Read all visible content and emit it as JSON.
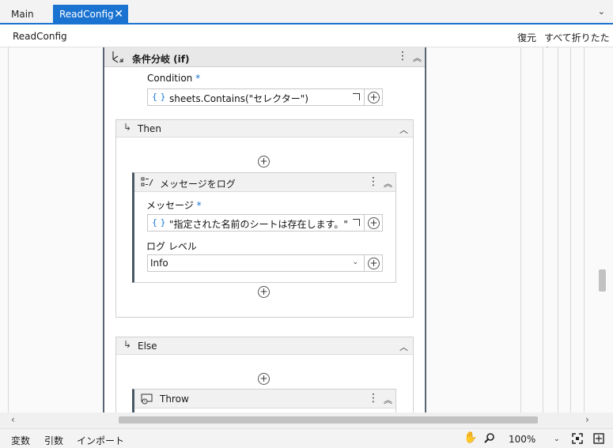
{
  "tabs": [
    {
      "label": "Main"
    },
    {
      "label": "ReadConfig"
    }
  ],
  "breadcrumb": "ReadConfig",
  "toolbar": {
    "restore_label": "復元",
    "collapse_all_label": "すべて折りたたむ"
  },
  "if_activity": {
    "title": "条件分岐 (if)",
    "condition_label": "Condition",
    "condition_value": "sheets.Contains(\"セレクター\")",
    "then_label": "Then",
    "else_label": "Else"
  },
  "log_activity": {
    "title": "メッセージをログ",
    "message_label": "メッセージ",
    "message_value": "\"指定された名前のシートは存在します。\"",
    "level_label": "ログ レベル",
    "level_value": "Info"
  },
  "throw_activity": {
    "title": "Throw"
  },
  "required_marker": "*",
  "expr_brace": "{ }",
  "statusbar": {
    "variables_label": "変数",
    "arguments_label": "引数",
    "imports_label": "インポート",
    "zoom_level": "100%"
  },
  "colors": {
    "accent": "#1a73d1",
    "card_border": "#5a6573"
  }
}
